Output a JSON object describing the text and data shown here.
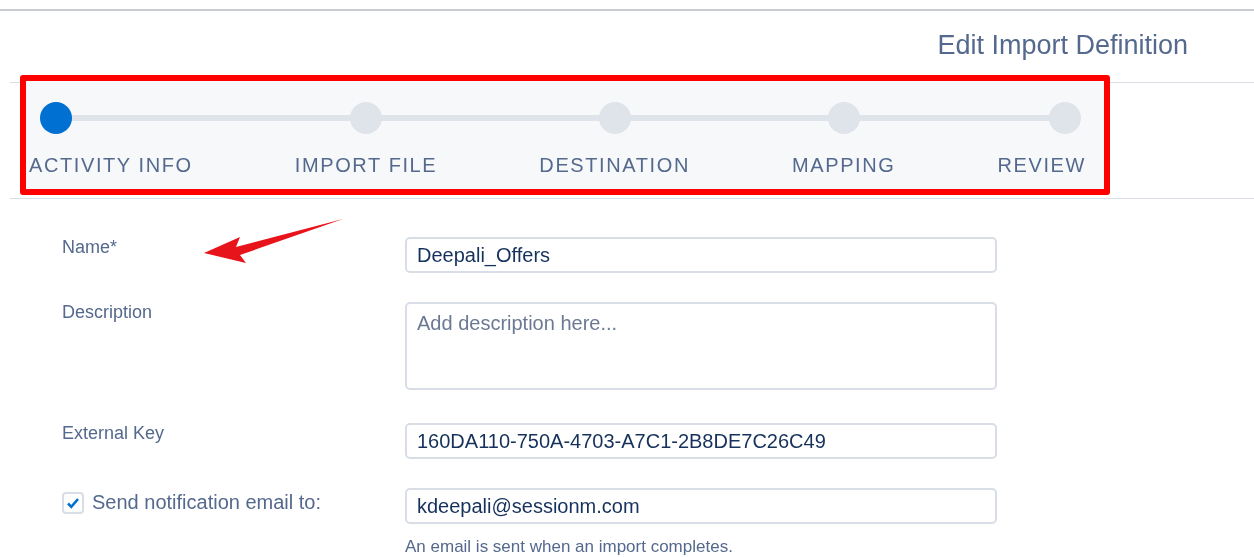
{
  "header": {
    "title": "Edit Import Definition"
  },
  "steps": [
    {
      "label": "ACTIVITY INFO",
      "selected": true
    },
    {
      "label": "IMPORT FILE",
      "selected": false
    },
    {
      "label": "DESTINATION",
      "selected": false
    },
    {
      "label": "MAPPING",
      "selected": false
    },
    {
      "label": "REVIEW",
      "selected": false
    }
  ],
  "annotations": {
    "highlight_box": true,
    "arrow": true
  },
  "form": {
    "fields": [
      {
        "kind": "text",
        "label": "Name*",
        "value": "Deepali_Offers"
      },
      {
        "kind": "textarea",
        "label": "Description",
        "placeholder": "Add description here..."
      },
      {
        "kind": "text",
        "label": "External Key",
        "value": "160DA110-750A-4703-A7C1-2B8DE7C26C49"
      },
      {
        "kind": "checkbox",
        "label": "Send notification email to:",
        "checked": true,
        "value": "kdeepali@sessionm.com",
        "hint": "An email is sent when an import completes."
      }
    ]
  }
}
